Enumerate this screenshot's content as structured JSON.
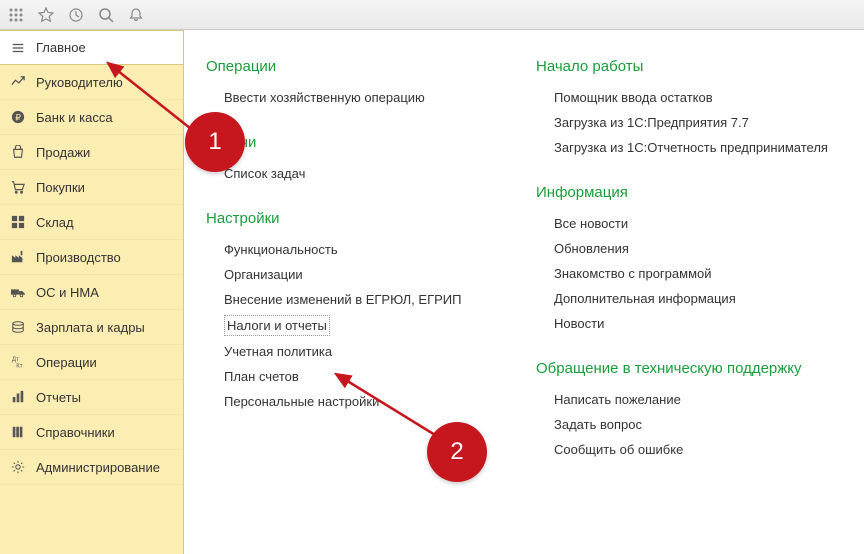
{
  "topbar": {
    "icons": [
      "apps",
      "star",
      "history",
      "search",
      "bell"
    ]
  },
  "sidebar": {
    "items": [
      {
        "icon": "menu",
        "label": "Главное",
        "active": true
      },
      {
        "icon": "chart",
        "label": "Руководителю"
      },
      {
        "icon": "ruble",
        "label": "Банк и касса"
      },
      {
        "icon": "bag",
        "label": "Продажи"
      },
      {
        "icon": "cart",
        "label": "Покупки"
      },
      {
        "icon": "grid",
        "label": "Склад"
      },
      {
        "icon": "factory",
        "label": "Производство"
      },
      {
        "icon": "truck",
        "label": "ОС и НМА"
      },
      {
        "icon": "coins",
        "label": "Зарплата и кадры"
      },
      {
        "icon": "dtkr",
        "label": "Операции"
      },
      {
        "icon": "bars",
        "label": "Отчеты"
      },
      {
        "icon": "books",
        "label": "Справочники"
      },
      {
        "icon": "gear",
        "label": "Администрирование"
      }
    ]
  },
  "content": {
    "left": [
      {
        "title": "Операции",
        "links": [
          {
            "label": "Ввести хозяйственную операцию"
          }
        ]
      },
      {
        "title": "Задачи",
        "links": [
          {
            "label": "Список задач"
          }
        ]
      },
      {
        "title": "Настройки",
        "links": [
          {
            "label": "Функциональность"
          },
          {
            "label": "Организации"
          },
          {
            "label": "Внесение изменений в ЕГРЮЛ, ЕГРИП"
          },
          {
            "label": "Налоги и отчеты",
            "boxed": true
          },
          {
            "label": "Учетная политика"
          },
          {
            "label": "План счетов"
          },
          {
            "label": "Персональные настройки"
          }
        ]
      }
    ],
    "right": [
      {
        "title": "Начало работы",
        "links": [
          {
            "label": "Помощник ввода остатков"
          },
          {
            "label": "Загрузка из 1С:Предприятия 7.7"
          },
          {
            "label": "Загрузка из 1С:Отчетность предпринимателя"
          }
        ]
      },
      {
        "title": "Информация",
        "links": [
          {
            "label": "Все новости"
          },
          {
            "label": "Обновления"
          },
          {
            "label": "Знакомство с программой"
          },
          {
            "label": "Дополнительная информация"
          },
          {
            "label": "Новости"
          }
        ]
      },
      {
        "title": "Обращение в техническую поддержку",
        "links": [
          {
            "label": "Написать пожелание"
          },
          {
            "label": "Задать вопрос"
          },
          {
            "label": "Сообщить об ошибке"
          }
        ]
      }
    ]
  },
  "annotations": {
    "circle1": "1",
    "circle2": "2"
  }
}
